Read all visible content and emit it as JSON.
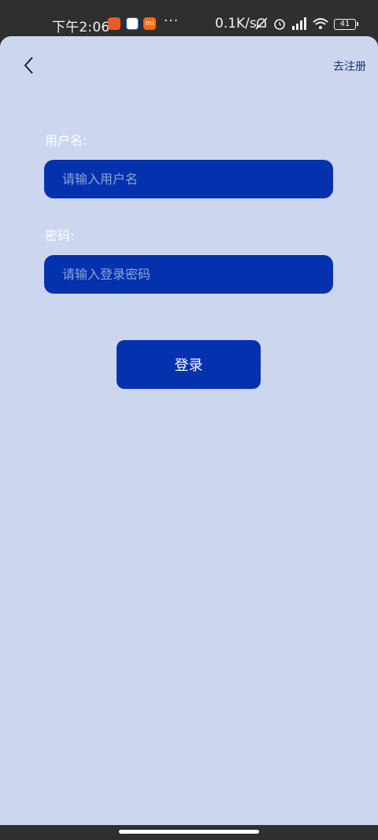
{
  "status_bar": {
    "time": "下午2:06",
    "more": "···",
    "network_speed": "0.1K/s",
    "battery_level": "41",
    "app_icons": [
      "taobao-icon",
      "baidu-icon",
      "mi-icon"
    ],
    "mi_label": "mi"
  },
  "header": {
    "back_icon": "chevron-left-icon",
    "register_link": "去注册"
  },
  "form": {
    "username_label": "用户名:",
    "username_placeholder": "请输入用户名",
    "password_label": "密码:",
    "password_placeholder": "请输入登录密码",
    "login_button": "登录"
  },
  "colors": {
    "screen_bg": "#ccd6ef",
    "primary": "#0432ae",
    "link": "#16327a"
  }
}
